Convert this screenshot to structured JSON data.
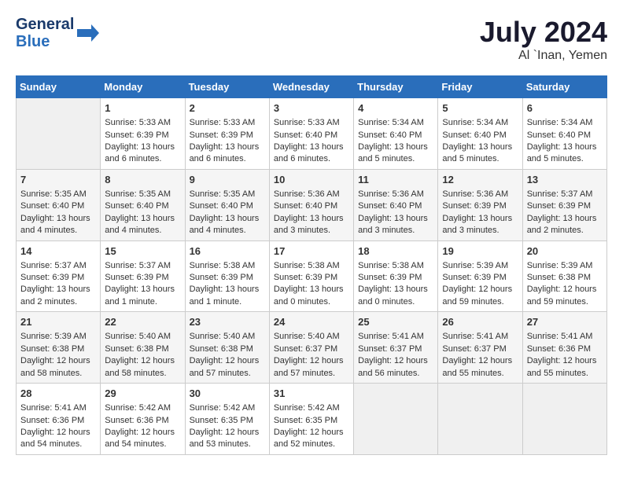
{
  "header": {
    "logo_line1": "General",
    "logo_line2": "Blue",
    "main_title": "July 2024",
    "subtitle": "Al `Inan, Yemen"
  },
  "calendar": {
    "days_of_week": [
      "Sunday",
      "Monday",
      "Tuesday",
      "Wednesday",
      "Thursday",
      "Friday",
      "Saturday"
    ],
    "weeks": [
      [
        {
          "day": null,
          "lines": []
        },
        {
          "day": "1",
          "lines": [
            "Sunrise: 5:33 AM",
            "Sunset: 6:39 PM",
            "Daylight: 13 hours",
            "and 6 minutes."
          ]
        },
        {
          "day": "2",
          "lines": [
            "Sunrise: 5:33 AM",
            "Sunset: 6:39 PM",
            "Daylight: 13 hours",
            "and 6 minutes."
          ]
        },
        {
          "day": "3",
          "lines": [
            "Sunrise: 5:33 AM",
            "Sunset: 6:40 PM",
            "Daylight: 13 hours",
            "and 6 minutes."
          ]
        },
        {
          "day": "4",
          "lines": [
            "Sunrise: 5:34 AM",
            "Sunset: 6:40 PM",
            "Daylight: 13 hours",
            "and 5 minutes."
          ]
        },
        {
          "day": "5",
          "lines": [
            "Sunrise: 5:34 AM",
            "Sunset: 6:40 PM",
            "Daylight: 13 hours",
            "and 5 minutes."
          ]
        },
        {
          "day": "6",
          "lines": [
            "Sunrise: 5:34 AM",
            "Sunset: 6:40 PM",
            "Daylight: 13 hours",
            "and 5 minutes."
          ]
        }
      ],
      [
        {
          "day": "7",
          "lines": [
            "Sunrise: 5:35 AM",
            "Sunset: 6:40 PM",
            "Daylight: 13 hours",
            "and 4 minutes."
          ]
        },
        {
          "day": "8",
          "lines": [
            "Sunrise: 5:35 AM",
            "Sunset: 6:40 PM",
            "Daylight: 13 hours",
            "and 4 minutes."
          ]
        },
        {
          "day": "9",
          "lines": [
            "Sunrise: 5:35 AM",
            "Sunset: 6:40 PM",
            "Daylight: 13 hours",
            "and 4 minutes."
          ]
        },
        {
          "day": "10",
          "lines": [
            "Sunrise: 5:36 AM",
            "Sunset: 6:40 PM",
            "Daylight: 13 hours",
            "and 3 minutes."
          ]
        },
        {
          "day": "11",
          "lines": [
            "Sunrise: 5:36 AM",
            "Sunset: 6:40 PM",
            "Daylight: 13 hours",
            "and 3 minutes."
          ]
        },
        {
          "day": "12",
          "lines": [
            "Sunrise: 5:36 AM",
            "Sunset: 6:39 PM",
            "Daylight: 13 hours",
            "and 3 minutes."
          ]
        },
        {
          "day": "13",
          "lines": [
            "Sunrise: 5:37 AM",
            "Sunset: 6:39 PM",
            "Daylight: 13 hours",
            "and 2 minutes."
          ]
        }
      ],
      [
        {
          "day": "14",
          "lines": [
            "Sunrise: 5:37 AM",
            "Sunset: 6:39 PM",
            "Daylight: 13 hours",
            "and 2 minutes."
          ]
        },
        {
          "day": "15",
          "lines": [
            "Sunrise: 5:37 AM",
            "Sunset: 6:39 PM",
            "Daylight: 13 hours",
            "and 1 minute."
          ]
        },
        {
          "day": "16",
          "lines": [
            "Sunrise: 5:38 AM",
            "Sunset: 6:39 PM",
            "Daylight: 13 hours",
            "and 1 minute."
          ]
        },
        {
          "day": "17",
          "lines": [
            "Sunrise: 5:38 AM",
            "Sunset: 6:39 PM",
            "Daylight: 13 hours",
            "and 0 minutes."
          ]
        },
        {
          "day": "18",
          "lines": [
            "Sunrise: 5:38 AM",
            "Sunset: 6:39 PM",
            "Daylight: 13 hours",
            "and 0 minutes."
          ]
        },
        {
          "day": "19",
          "lines": [
            "Sunrise: 5:39 AM",
            "Sunset: 6:39 PM",
            "Daylight: 12 hours",
            "and 59 minutes."
          ]
        },
        {
          "day": "20",
          "lines": [
            "Sunrise: 5:39 AM",
            "Sunset: 6:38 PM",
            "Daylight: 12 hours",
            "and 59 minutes."
          ]
        }
      ],
      [
        {
          "day": "21",
          "lines": [
            "Sunrise: 5:39 AM",
            "Sunset: 6:38 PM",
            "Daylight: 12 hours",
            "and 58 minutes."
          ]
        },
        {
          "day": "22",
          "lines": [
            "Sunrise: 5:40 AM",
            "Sunset: 6:38 PM",
            "Daylight: 12 hours",
            "and 58 minutes."
          ]
        },
        {
          "day": "23",
          "lines": [
            "Sunrise: 5:40 AM",
            "Sunset: 6:38 PM",
            "Daylight: 12 hours",
            "and 57 minutes."
          ]
        },
        {
          "day": "24",
          "lines": [
            "Sunrise: 5:40 AM",
            "Sunset: 6:37 PM",
            "Daylight: 12 hours",
            "and 57 minutes."
          ]
        },
        {
          "day": "25",
          "lines": [
            "Sunrise: 5:41 AM",
            "Sunset: 6:37 PM",
            "Daylight: 12 hours",
            "and 56 minutes."
          ]
        },
        {
          "day": "26",
          "lines": [
            "Sunrise: 5:41 AM",
            "Sunset: 6:37 PM",
            "Daylight: 12 hours",
            "and 55 minutes."
          ]
        },
        {
          "day": "27",
          "lines": [
            "Sunrise: 5:41 AM",
            "Sunset: 6:36 PM",
            "Daylight: 12 hours",
            "and 55 minutes."
          ]
        }
      ],
      [
        {
          "day": "28",
          "lines": [
            "Sunrise: 5:41 AM",
            "Sunset: 6:36 PM",
            "Daylight: 12 hours",
            "and 54 minutes."
          ]
        },
        {
          "day": "29",
          "lines": [
            "Sunrise: 5:42 AM",
            "Sunset: 6:36 PM",
            "Daylight: 12 hours",
            "and 54 minutes."
          ]
        },
        {
          "day": "30",
          "lines": [
            "Sunrise: 5:42 AM",
            "Sunset: 6:35 PM",
            "Daylight: 12 hours",
            "and 53 minutes."
          ]
        },
        {
          "day": "31",
          "lines": [
            "Sunrise: 5:42 AM",
            "Sunset: 6:35 PM",
            "Daylight: 12 hours",
            "and 52 minutes."
          ]
        },
        {
          "day": null,
          "lines": []
        },
        {
          "day": null,
          "lines": []
        },
        {
          "day": null,
          "lines": []
        }
      ]
    ]
  }
}
